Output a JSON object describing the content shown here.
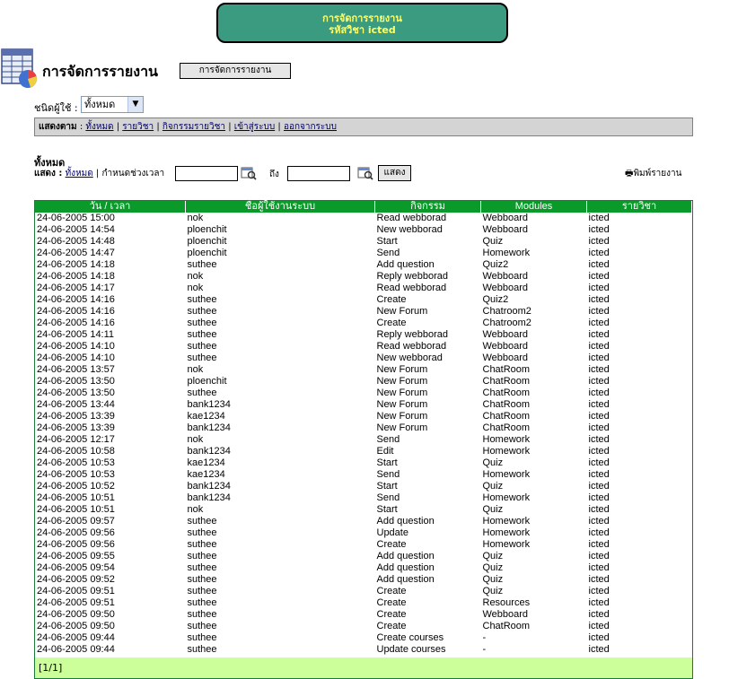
{
  "banner": {
    "line1": "การจัดการรายงาน",
    "line2": "รหัสวิชา icted"
  },
  "page": {
    "title": "การจัดการรายงาน",
    "header_button": "การจัดการรายงาน"
  },
  "user_type": {
    "label": "ชนิดผู้ใช้ :",
    "selected": "ทั้งหมด"
  },
  "nav": {
    "label": "แสดงตาม",
    "links": [
      "ทั้งหมด",
      "รายวิชา",
      "กิจกรรมรายวิชา",
      "เข้าสู่ระบบ",
      "ออกจากระบบ"
    ]
  },
  "section": {
    "title": "ทั้งหมด"
  },
  "filter": {
    "label": "แสดง :",
    "all_link": "ทั้งหมด",
    "range_label": "กำหนดช่วงเวลา",
    "to_label": "ถึง",
    "show_button": "แสดง",
    "print_label": "พิมพ์รายงาน"
  },
  "table": {
    "columns": [
      "วัน / เวลา",
      "ชื่อผู้ใช้งานระบบ",
      "กิจกรรม",
      "Modules",
      "รายวิชา"
    ],
    "rows": [
      [
        "24-06-2005 15:00",
        "nok",
        "Read webborad",
        "Webboard",
        "icted"
      ],
      [
        "24-06-2005 14:54",
        "ploenchit",
        "New webborad",
        "Webboard",
        "icted"
      ],
      [
        "24-06-2005 14:48",
        "ploenchit",
        "Start",
        "Quiz",
        "icted"
      ],
      [
        "24-06-2005 14:47",
        "ploenchit",
        "Send",
        "Homework",
        "icted"
      ],
      [
        "24-06-2005 14:18",
        "suthee",
        "Add question",
        "Quiz2",
        "icted"
      ],
      [
        "24-06-2005 14:18",
        "nok",
        "Reply webborad",
        "Webboard",
        "icted"
      ],
      [
        "24-06-2005 14:17",
        "nok",
        "Read webborad",
        "Webboard",
        "icted"
      ],
      [
        "24-06-2005 14:16",
        "suthee",
        "Create",
        "Quiz2",
        "icted"
      ],
      [
        "24-06-2005 14:16",
        "suthee",
        "New Forum",
        "Chatroom2",
        "icted"
      ],
      [
        "24-06-2005 14:16",
        "suthee",
        "Create",
        "Chatroom2",
        "icted"
      ],
      [
        "24-06-2005 14:11",
        "suthee",
        "Reply webborad",
        "Webboard",
        "icted"
      ],
      [
        "24-06-2005 14:10",
        "suthee",
        "Read webborad",
        "Webboard",
        "icted"
      ],
      [
        "24-06-2005 14:10",
        "suthee",
        "New webborad",
        "Webboard",
        "icted"
      ],
      [
        "24-06-2005 13:57",
        "nok",
        "New Forum",
        "ChatRoom",
        "icted"
      ],
      [
        "24-06-2005 13:50",
        "ploenchit",
        "New Forum",
        "ChatRoom",
        "icted"
      ],
      [
        "24-06-2005 13:50",
        "suthee",
        "New Forum",
        "ChatRoom",
        "icted"
      ],
      [
        "24-06-2005 13:44",
        "bank1234",
        "New Forum",
        "ChatRoom",
        "icted"
      ],
      [
        "24-06-2005 13:39",
        "kae1234",
        "New Forum",
        "ChatRoom",
        "icted"
      ],
      [
        "24-06-2005 13:39",
        "bank1234",
        "New Forum",
        "ChatRoom",
        "icted"
      ],
      [
        "24-06-2005 12:17",
        "nok",
        "Send",
        "Homework",
        "icted"
      ],
      [
        "24-06-2005 10:58",
        "bank1234",
        "Edit",
        "Homework",
        "icted"
      ],
      [
        "24-06-2005 10:53",
        "kae1234",
        "Start",
        "Quiz",
        "icted"
      ],
      [
        "24-06-2005 10:53",
        "kae1234",
        "Send",
        "Homework",
        "icted"
      ],
      [
        "24-06-2005 10:52",
        "bank1234",
        "Start",
        "Quiz",
        "icted"
      ],
      [
        "24-06-2005 10:51",
        "bank1234",
        "Send",
        "Homework",
        "icted"
      ],
      [
        "24-06-2005 10:51",
        "nok",
        "Start",
        "Quiz",
        "icted"
      ],
      [
        "24-06-2005 09:57",
        "suthee",
        "Add question",
        "Homework",
        "icted"
      ],
      [
        "24-06-2005 09:56",
        "suthee",
        "Update",
        "Homework",
        "icted"
      ],
      [
        "24-06-2005 09:56",
        "suthee",
        "Create",
        "Homework",
        "icted"
      ],
      [
        "24-06-2005 09:55",
        "suthee",
        "Add question",
        "Quiz",
        "icted"
      ],
      [
        "24-06-2005 09:54",
        "suthee",
        "Add question",
        "Quiz",
        "icted"
      ],
      [
        "24-06-2005 09:52",
        "suthee",
        "Add question",
        "Quiz",
        "icted"
      ],
      [
        "24-06-2005 09:51",
        "suthee",
        "Create",
        "Quiz",
        "icted"
      ],
      [
        "24-06-2005 09:51",
        "suthee",
        "Create",
        "Resources",
        "icted"
      ],
      [
        "24-06-2005 09:50",
        "suthee",
        "Create",
        "Webboard",
        "icted"
      ],
      [
        "24-06-2005 09:50",
        "suthee",
        "Create",
        "ChatRoom",
        "icted"
      ],
      [
        "24-06-2005 09:44",
        "suthee",
        "Create courses",
        "-",
        "icted"
      ],
      [
        "24-06-2005 09:44",
        "suthee",
        "Update courses",
        "-",
        "icted"
      ]
    ],
    "pager": "[1/1]"
  },
  "colors": {
    "banner_bg": "#3a9b81",
    "banner_text": "#ffff66",
    "table_header": "#0a9a2a",
    "pager_bg": "#ccff99",
    "nav_bg": "#d4d4d4"
  }
}
